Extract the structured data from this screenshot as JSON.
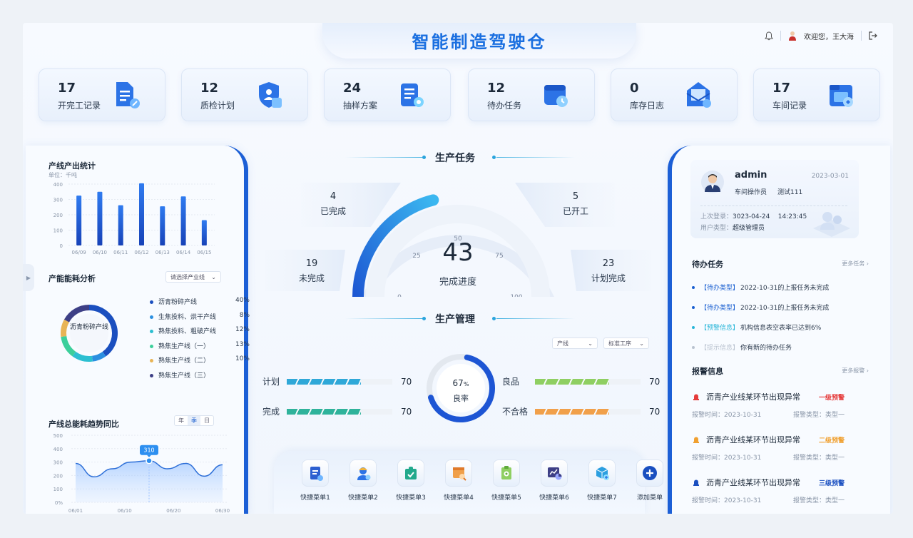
{
  "header": {
    "title": "智能制造驾驶仓",
    "welcome": "欢迎您，王大海"
  },
  "stat_cards": [
    {
      "value": "17",
      "label": "开完工记录",
      "icon": "document-edit-icon"
    },
    {
      "value": "12",
      "label": "质检计划",
      "icon": "shield-user-icon"
    },
    {
      "value": "24",
      "label": "抽样方案",
      "icon": "list-search-icon"
    },
    {
      "value": "12",
      "label": "待办任务",
      "icon": "calendar-clock-icon"
    },
    {
      "value": "0",
      "label": "库存日志",
      "icon": "mail-edit-icon"
    },
    {
      "value": "17",
      "label": "车间记录",
      "icon": "folder-box-icon"
    }
  ],
  "left": {
    "output_title": "产线产出统计",
    "output_unit": "单位：千吨",
    "energy_title": "产能能耗分析",
    "energy_select": "请选择产业线",
    "donut_center": "沥青粉碎产线",
    "trend_title": "产线总能耗趋势同比",
    "trend_tabs": [
      "年",
      "季",
      "日"
    ],
    "trend_callout": "310"
  },
  "chart_data": [
    {
      "type": "bar",
      "title": "产线产出统计",
      "categories": [
        "06/09",
        "06/10",
        "06/11",
        "06/12",
        "06/13",
        "06/14",
        "06/15"
      ],
      "values": [
        325,
        350,
        262,
        405,
        255,
        320,
        165
      ],
      "ylim": [
        0,
        400
      ],
      "yticks": [
        "400",
        "300",
        "200",
        "100",
        "0"
      ],
      "grid": true,
      "color": "#1f5fd6"
    },
    {
      "type": "pie",
      "title": "产能能耗分析",
      "series": [
        {
          "name": "沥青粉碎产线",
          "value": 40,
          "label": "40%",
          "color": "#1b4fbf"
        },
        {
          "name": "生焦投料、烘干产线",
          "value": 8,
          "label": "8%",
          "color": "#2b8fe0"
        },
        {
          "name": "熟焦投料、粗破产线",
          "value": 12,
          "label": "12%",
          "color": "#2cbfd1"
        },
        {
          "name": "熟焦生产线（一）",
          "value": 13,
          "label": "13%",
          "color": "#3ccf9b"
        },
        {
          "name": "熟焦生产线（二）",
          "value": 10,
          "label": "10%",
          "color": "#e8b456"
        },
        {
          "name": "熟焦生产线（三）",
          "value": 17,
          "label": "",
          "color": "#3d3f86"
        }
      ]
    },
    {
      "type": "area",
      "title": "产线总能耗趋势同比",
      "x": [
        "06/01",
        "06/05",
        "06/10",
        "06/15",
        "06/20",
        "06/25",
        "06/30"
      ],
      "xticks": [
        "06/01",
        "06/10",
        "06/20",
        "06/30"
      ],
      "values": [
        290,
        190,
        250,
        300,
        310,
        250,
        290,
        195,
        280
      ],
      "ylim": [
        0,
        500
      ],
      "yticks": [
        "500",
        "400",
        "300",
        "200",
        "100",
        "0%"
      ],
      "grid": true,
      "color": "#2d6fd8"
    }
  ],
  "center": {
    "production_title": "生产任务",
    "wings": [
      {
        "value": "4",
        "label": "已完成"
      },
      {
        "value": "5",
        "label": "已开工"
      },
      {
        "value": "19",
        "label": "未完成"
      },
      {
        "value": "23",
        "label": "计划完成"
      }
    ],
    "gauge": {
      "value": 43,
      "label": "完成进度",
      "ticks": [
        "0",
        "25",
        "50",
        "75",
        "100"
      ],
      "display": "43"
    },
    "management_title": "生产管理",
    "filter_line": "产线",
    "filter_process": "标准工序",
    "bars_left": [
      {
        "label": "计划",
        "value": "70",
        "pct": 70
      },
      {
        "label": "完成",
        "value": "70",
        "pct": 70
      }
    ],
    "bars_right": [
      {
        "label": "良品",
        "value": "70",
        "pct": 70
      },
      {
        "label": "不合格",
        "value": "70",
        "pct": 70
      }
    ],
    "ring": {
      "value": 67,
      "pct_text": "67",
      "pct_sym": "%",
      "label": "良率"
    },
    "quick_menu": [
      {
        "label": "快捷菜单1",
        "icon": "form-gear-icon"
      },
      {
        "label": "快捷菜单2",
        "icon": "worker-star-icon"
      },
      {
        "label": "快捷菜单3",
        "icon": "puzzle-check-icon"
      },
      {
        "label": "快捷菜单4",
        "icon": "table-search-icon"
      },
      {
        "label": "快捷菜单5",
        "icon": "clipboard-gear-icon"
      },
      {
        "label": "快捷菜单6",
        "icon": "chart-pie-icon"
      },
      {
        "label": "快捷菜单7",
        "icon": "box-plus-icon"
      },
      {
        "label": "添加菜单",
        "icon": "plus-circle-icon"
      }
    ]
  },
  "right": {
    "user": {
      "name": "admin",
      "date": "2023-03-01",
      "role": "车间操作员",
      "team": "测试111",
      "last_login_label": "上次登录：",
      "last_login_date": "3023-04-24",
      "last_login_time": "14:23:45",
      "user_type_label": "用户类型：",
      "user_type": "超级管理员"
    },
    "todo_title": "待办任务",
    "todo_more": "更多任务",
    "todos": [
      {
        "tag": "【待办类型】",
        "text": "2022-10-31的上报任务未完成",
        "color": "#1a5fd0"
      },
      {
        "tag": "【待办类型】",
        "text": "2022-10-31的上报任务未完成",
        "color": "#1a5fd0"
      },
      {
        "tag": "【预警信息】",
        "text": "机构信息表空表率已达到6%",
        "color": "#27b5d8"
      },
      {
        "tag": "【提示信息】",
        "text": "你有新的待办任务",
        "color": "#b9c2cf"
      }
    ],
    "alarm_title": "报警信息",
    "alarm_more": "更多报警",
    "alarms": [
      {
        "text": "沥青产业线某环节出现异常",
        "level": "一级预警",
        "time": "报警时间：2023-10-31",
        "type": "报警类型：类型一",
        "color": "#e53b3b"
      },
      {
        "text": "沥青产业线某环节出现异常",
        "level": "二级预警",
        "time": "报警时间：2023-10-31",
        "type": "报警类型：类型一",
        "color": "#f0a030"
      },
      {
        "text": "沥青产业线某环节出现异常",
        "level": "三级预警",
        "time": "报警时间：2023-10-31",
        "type": "报警类型：类型一",
        "color": "#1a4fc0"
      }
    ]
  }
}
